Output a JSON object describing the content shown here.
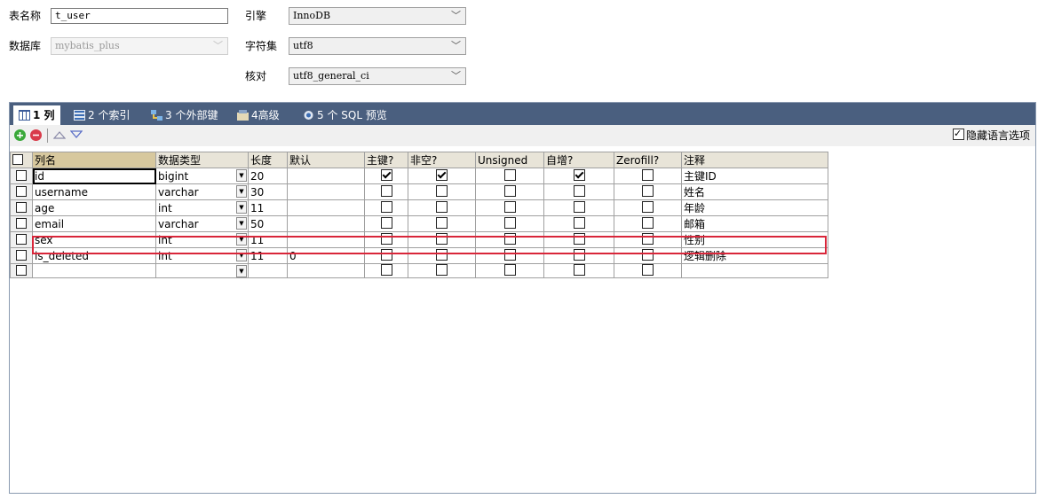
{
  "form": {
    "table_name_label": "表名称",
    "table_name_value": "t_user",
    "database_label": "数据库",
    "database_value": "mybatis_plus",
    "engine_label": "引擎",
    "engine_value": "InnoDB",
    "charset_label": "字符集",
    "charset_value": "utf8",
    "collation_label": "核对",
    "collation_value": "utf8_general_ci"
  },
  "tabs": [
    {
      "label": "1 列",
      "icon": "columns-icon"
    },
    {
      "label": "2 个索引",
      "icon": "index-icon"
    },
    {
      "label": "3 个外部键",
      "icon": "foreign-key-icon"
    },
    {
      "label": "4高级",
      "icon": "advanced-icon"
    },
    {
      "label": "5 个 SQL 预览",
      "icon": "sql-preview-icon"
    }
  ],
  "toolbar": {
    "hide_lang_label": "隐藏语言选项",
    "hide_lang_checked": true
  },
  "columns": [
    "列名",
    "数据类型",
    "长度",
    "默认",
    "主键?",
    "非空?",
    "Unsigned",
    "自增?",
    "Zerofill?",
    "注释"
  ],
  "rows": [
    {
      "name": "id",
      "type": "bigint",
      "length": "20",
      "default": "",
      "pk": true,
      "notnull": true,
      "unsigned": false,
      "autoinc": true,
      "zerofill": false,
      "comment": "主键ID"
    },
    {
      "name": "username",
      "type": "varchar",
      "length": "30",
      "default": "",
      "pk": false,
      "notnull": false,
      "unsigned": false,
      "autoinc": false,
      "zerofill": false,
      "comment": "姓名"
    },
    {
      "name": "age",
      "type": "int",
      "length": "11",
      "default": "",
      "pk": false,
      "notnull": false,
      "unsigned": false,
      "autoinc": false,
      "zerofill": false,
      "comment": "年龄"
    },
    {
      "name": "email",
      "type": "varchar",
      "length": "50",
      "default": "",
      "pk": false,
      "notnull": false,
      "unsigned": false,
      "autoinc": false,
      "zerofill": false,
      "comment": "邮箱"
    },
    {
      "name": "sex",
      "type": "int",
      "length": "11",
      "default": "",
      "pk": false,
      "notnull": false,
      "unsigned": false,
      "autoinc": false,
      "zerofill": false,
      "comment": "性别"
    },
    {
      "name": "is_deleted",
      "type": "int",
      "length": "11",
      "default": "0",
      "pk": false,
      "notnull": false,
      "unsigned": false,
      "autoinc": false,
      "zerofill": false,
      "comment": "逻辑删除"
    },
    {
      "name": "",
      "type": "",
      "length": "",
      "default": "",
      "pk": false,
      "notnull": false,
      "unsigned": false,
      "autoinc": false,
      "zerofill": false,
      "comment": ""
    }
  ],
  "colors": {
    "tabbar": "#4a5f7f",
    "highlight": "#d9263a",
    "header_bg": "#e8e4d8"
  }
}
